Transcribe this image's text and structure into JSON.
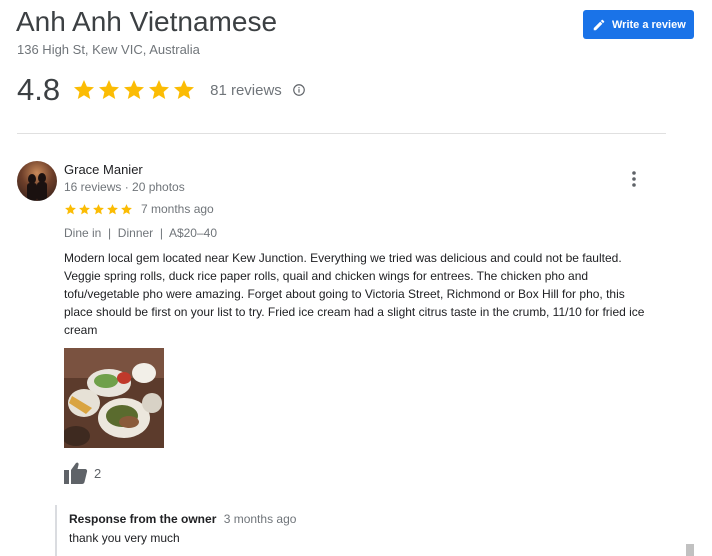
{
  "place": {
    "name": "Anh Anh Vietnamese",
    "address": "136 High St, Kew VIC, Australia",
    "rating": "4.8",
    "stars": 5,
    "review_count": "81 reviews"
  },
  "actions": {
    "write_review_label": "Write a review"
  },
  "review": {
    "author": "Grace Manier",
    "author_meta": "16 reviews · 20 photos",
    "stars": 5,
    "date": "7 months ago",
    "tags": "Dine in  |  Dinner  |  A$20–40",
    "text": "Modern local gem located near Kew Junction. Everything we tried was delicious and could not be faulted. Veggie spring rolls, duck rice paper rolls, quail and chicken wings for entrees. The chicken pho and tofu/vegetable pho were amazing. Forget about going to Victoria Street, Richmond or Box Hill for pho, this place should be first on your list to try. Fried ice cream had a slight citrus taste in the crumb, 11/10 for fried  ice cream",
    "likes": "2",
    "owner_response": {
      "title": "Response from the owner",
      "date": "3 months ago",
      "text": "thank you very much"
    }
  },
  "colors": {
    "star": "#fbbc04",
    "accent": "#1a73e8",
    "muted": "#70757a"
  },
  "icons": {
    "edit": "pencil-icon",
    "info": "info-icon",
    "more": "more-vert-icon",
    "like": "thumb-up-icon"
  }
}
